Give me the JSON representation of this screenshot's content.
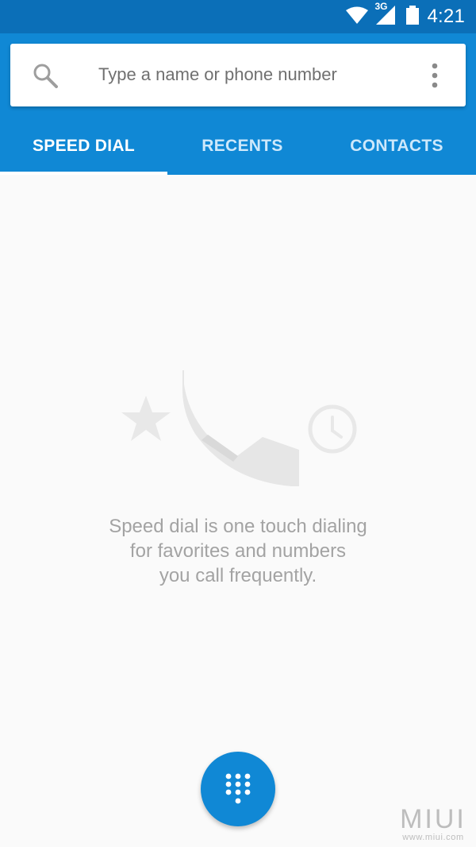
{
  "status_bar": {
    "network": "3G",
    "time": "4:21",
    "icons": [
      "wifi-icon",
      "signal-icon",
      "battery-icon"
    ]
  },
  "search": {
    "placeholder": "Type a name or phone number"
  },
  "tabs": [
    {
      "label": "SPEED DIAL",
      "active": true
    },
    {
      "label": "RECENTS",
      "active": false
    },
    {
      "label": "CONTACTS",
      "active": false
    }
  ],
  "empty_state": {
    "line1": "Speed dial is one touch dialing",
    "line2": "for favorites and numbers",
    "line3": "you call frequently.",
    "icons": [
      "star-icon",
      "phone-icon",
      "clock-icon"
    ]
  },
  "fab": {
    "icon": "dialpad-icon"
  },
  "watermark": {
    "logo": "MIUI",
    "url": "www.miui.com"
  },
  "colors": {
    "status_bar": "#0b6fb8",
    "header": "#1088d5",
    "background": "#fafafa",
    "active_tab": "#ffffff",
    "inactive_tab": "#cde8fb"
  }
}
